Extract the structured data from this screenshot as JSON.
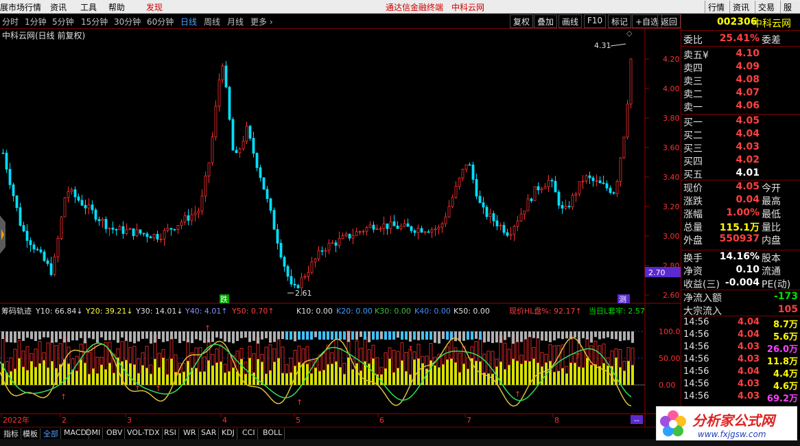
{
  "menubar": {
    "items": [
      "展市场行情",
      "资讯",
      "工具",
      "帮助"
    ],
    "highlight": "发现",
    "center": [
      "通达信金融终端",
      "中科云网"
    ],
    "right": [
      "行情",
      "资讯",
      "交易",
      "服务"
    ]
  },
  "toolbar": {
    "periods": [
      "分时",
      "1分钟",
      "5分钟",
      "15分钟",
      "30分钟",
      "60分钟",
      "日线",
      "周线",
      "月线",
      "更多 ›"
    ],
    "active": "日线",
    "right_buttons": [
      "复权",
      "叠加",
      "画线",
      "F10",
      "标记",
      "+自选",
      "返回"
    ]
  },
  "chart": {
    "title": "中科云网(日线 前复权)",
    "price_axis": [
      "4.20",
      "4.00",
      "3.80",
      "3.60",
      "3.40",
      "3.20",
      "3.00",
      "2.80",
      "2.60"
    ],
    "current_tag": "2.70",
    "high_label": "4.31",
    "low_label": "2.61",
    "marker_die": "跌",
    "marker_zhe": "测",
    "colors": {
      "up": "#ff3030",
      "down": "#00e0ff",
      "axis": "#a00000",
      "tag": "#5a2ad0"
    }
  },
  "indicator": {
    "name": "筹码轨迹",
    "values": [
      {
        "label": "Y10: 66.84",
        "arrow": "down",
        "color": "#e0e0e0"
      },
      {
        "label": "Y20: 39.21",
        "arrow": "down",
        "color": "#ffff40"
      },
      {
        "label": "Y30: 14.01",
        "arrow": "down",
        "color": "#e0e0e0"
      },
      {
        "label": "Y40: 4.01",
        "arrow": "up",
        "color": "#9090ff"
      },
      {
        "label": "Y50: 0.70",
        "arrow": "up",
        "color": "#ff4040"
      },
      {
        "label": "K10: 0.00",
        "color": "#e0e0e0"
      },
      {
        "label": "K20: 0.00",
        "color": "#40a0ff"
      },
      {
        "label": "K30: 0.00",
        "color": "#40c040"
      },
      {
        "label": "K40: 0.00",
        "color": "#4090ff"
      },
      {
        "label": "K50: 0.00",
        "color": "#e0e0e0"
      },
      {
        "label": "现价HL盘%: 92.17",
        "arrow": "up",
        "color": "#ff4040"
      },
      {
        "label": "当日L套牢: 2.57",
        "color": "#00e000"
      }
    ],
    "axis": [
      "100.0",
      "50.00",
      "0.00"
    ]
  },
  "time_axis": [
    "2022年",
    "2",
    "3",
    "4",
    "5",
    "6",
    "7",
    "8",
    "--"
  ],
  "quote": {
    "code": "002306",
    "name": "中科云网",
    "webi": {
      "label": "委比",
      "value": "25.41%",
      "right": "委差"
    },
    "sells": [
      {
        "label": "卖五",
        "mark": "¥",
        "price": "4.10"
      },
      {
        "label": "卖四",
        "price": "4.09"
      },
      {
        "label": "卖三",
        "price": "4.08"
      },
      {
        "label": "卖二",
        "price": "4.07"
      },
      {
        "label": "卖一",
        "price": "4.06"
      }
    ],
    "buys": [
      {
        "label": "买一",
        "price": "4.05"
      },
      {
        "label": "买二",
        "price": "4.04"
      },
      {
        "label": "买三",
        "price": "4.03"
      },
      {
        "label": "买四",
        "price": "4.02"
      },
      {
        "label": "买五",
        "price": "4.01"
      }
    ],
    "stats": [
      {
        "l": "现价",
        "v": "4.05",
        "r": "今开",
        "c": "red"
      },
      {
        "l": "涨跌",
        "v": "0.04",
        "r": "最高",
        "c": "red"
      },
      {
        "l": "涨幅",
        "v": "1.00%",
        "r": "最低",
        "c": "red"
      },
      {
        "l": "总量",
        "v": "115.1万",
        "r": "量比",
        "c": "yel"
      },
      {
        "l": "外盘",
        "v": "550937",
        "r": "内盘",
        "c": "red"
      }
    ],
    "stats2": [
      {
        "l": "换手",
        "v": "14.16%",
        "r": "股本",
        "c": "wht"
      },
      {
        "l": "净资",
        "v": "0.10",
        "r": "流通",
        "c": "wht"
      },
      {
        "l": "收益(三)",
        "v": "-0.004",
        "r": "PE(动)",
        "c": "wht"
      }
    ],
    "flows": [
      {
        "l": "净流入额",
        "v": "-173",
        "c": "grn"
      },
      {
        "l": "大宗流入",
        "v": "105",
        "c": "red"
      }
    ],
    "ticks": [
      {
        "t": "14:56",
        "p": "4.04",
        "v": "8.7万",
        "pc": "red",
        "vc": "yel"
      },
      {
        "t": "14:56",
        "p": "4.04",
        "v": "5.6万",
        "pc": "red",
        "vc": "yel"
      },
      {
        "t": "14:56",
        "p": "4.03",
        "v": "26.0万",
        "pc": "red",
        "vc": "mag"
      },
      {
        "t": "14:56",
        "p": "4.03",
        "v": "11.8万",
        "pc": "red",
        "vc": "yel"
      },
      {
        "t": "14:56",
        "p": "4.04",
        "v": "4.4万",
        "pc": "red",
        "vc": "yel"
      },
      {
        "t": "14:56",
        "p": "4.03",
        "v": "4.6万",
        "pc": "red",
        "vc": "yel"
      },
      {
        "t": "14:56",
        "p": "4.03",
        "v": "69.2万",
        "pc": "red",
        "vc": "mag"
      }
    ]
  },
  "bottombar": [
    "指标",
    "模板",
    "全部",
    "MACD",
    "DMI",
    "OBV",
    "VOL-TDX",
    "RSI",
    "WR",
    "SAR",
    "KDJ",
    "CCI",
    "BOLL"
  ],
  "bottom_active": "全部",
  "watermark": {
    "title": "分析家公式网",
    "url": "www.fxjgsw.com"
  }
}
